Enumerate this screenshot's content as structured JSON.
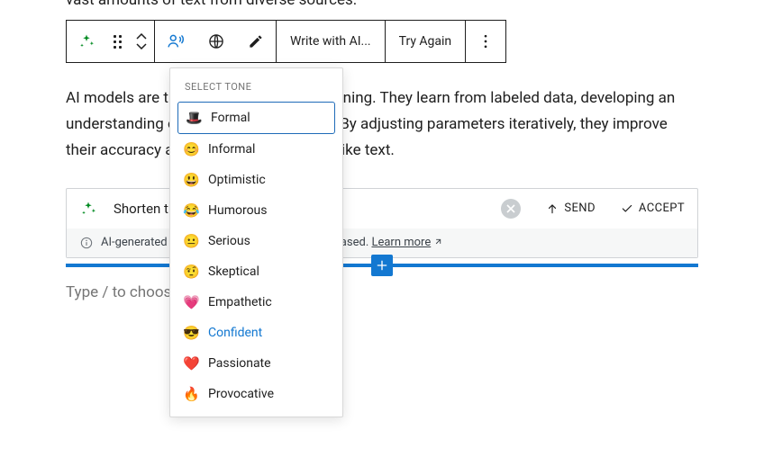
{
  "partial_top": "vast amounts of text from diverse sources.",
  "toolbar": {
    "write_label": "Write with AI...",
    "try_again_label": "Try Again"
  },
  "paragraph": "AI models are trained using machine learning. They learn from labeled data, developing an understanding of language and context. By adjusting parameters iteratively, they improve their accuracy and can generate human-like text.",
  "ai_box": {
    "input_text": "Shorten the content",
    "send_label": "SEND",
    "accept_label": "ACCEPT",
    "note_prefix": "AI-generated content could be inaccurate or biased. ",
    "learn_more": "Learn more"
  },
  "placeholder": "Type / to choose a block",
  "dropdown": {
    "header": "SELECT TONE",
    "items": [
      {
        "emoji": "🎩",
        "label": "Formal",
        "selected": true
      },
      {
        "emoji": "😊",
        "label": "Informal"
      },
      {
        "emoji": "😃",
        "label": "Optimistic"
      },
      {
        "emoji": "😂",
        "label": "Humorous"
      },
      {
        "emoji": "😐",
        "label": "Serious"
      },
      {
        "emoji": "🤨",
        "label": "Skeptical"
      },
      {
        "emoji": "💗",
        "label": "Empathetic"
      },
      {
        "emoji": "😎",
        "label": "Confident",
        "hover": true
      },
      {
        "emoji": "❤️",
        "label": "Passionate"
      },
      {
        "emoji": "🔥",
        "label": "Provocative"
      }
    ]
  }
}
